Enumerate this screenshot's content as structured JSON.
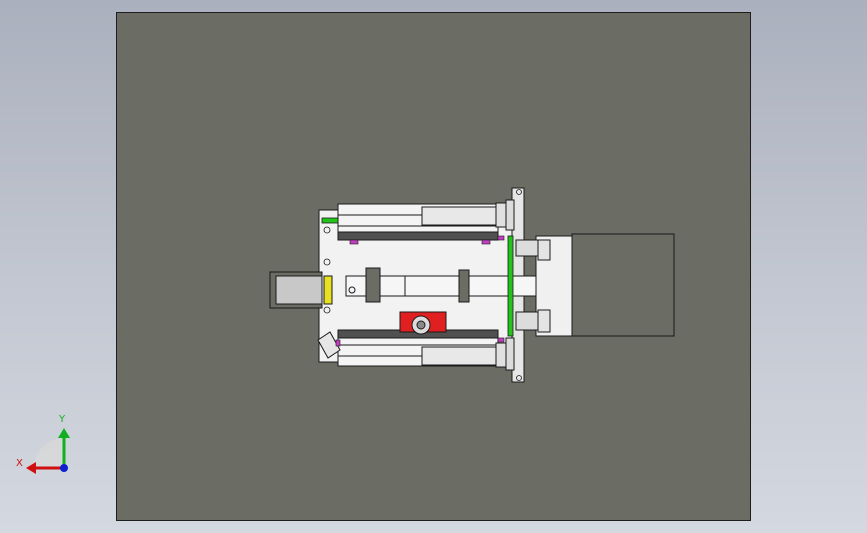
{
  "viewport": {
    "name": "cad-graphics-area",
    "background_top": "#aab0bd",
    "background_bottom": "#d4d8e0",
    "plate_color": "#6b6c64"
  },
  "triad": {
    "x_label": "X",
    "y_label": "Y",
    "x_color": "#d01010",
    "y_color": "#10b020",
    "z_color": "#1020d0"
  },
  "model": {
    "frame_color": "#f2f2f2",
    "edge_color": "#1a1a1a",
    "accent_green": "#22c41a",
    "accent_red": "#e02020",
    "accent_yellow": "#e8e020",
    "accent_magenta": "#c040c0",
    "motor_color": "#6b6c64"
  }
}
